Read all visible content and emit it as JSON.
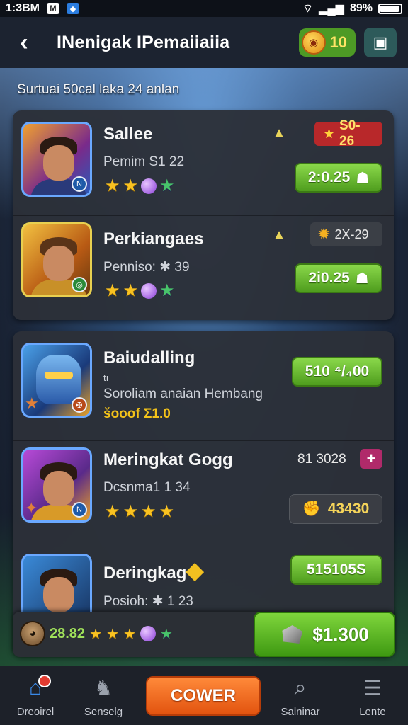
{
  "status_bar": {
    "time": "1:3BM",
    "battery": "89%",
    "battery_level": 0.89
  },
  "header": {
    "title": "INenigak IPemaiiaiia",
    "coins": "10"
  },
  "subtitle": "Surtuai 50cal laka 24 anlan",
  "group1": {
    "items": [
      {
        "name": "Sallee",
        "detail": "Pemim S1 22",
        "price_tag": "S0-26",
        "action": "2:0.25",
        "stars": 2
      },
      {
        "name": "Perkiangaes",
        "detail": "Penniso: ✱ 39",
        "price_tag": "2X-29",
        "action": "2i0.25",
        "stars": 2
      }
    ]
  },
  "group2": {
    "items": [
      {
        "name": "Baiudalling",
        "line1": "tı",
        "detail": "Soroliam anaian Hembang",
        "extra": "šooof Σ1.0",
        "action": "510 ⁴/₄00"
      },
      {
        "name": "Meringkat Gogg",
        "detail": "Dcsnma1 1 34",
        "price_text": "81 3028",
        "action": "43430",
        "stars": 4
      },
      {
        "name": "Deringkag",
        "detail": "Posioh: ✱ 1 23",
        "action": "515105S"
      }
    ]
  },
  "buy_bar": {
    "value": "28.82",
    "price": "$1.300"
  },
  "nav": {
    "items": [
      {
        "label": "Dreoirel"
      },
      {
        "label": "Senselg"
      },
      {
        "label": "Salninar"
      },
      {
        "label": "Lente"
      }
    ],
    "cta_label": "COWER"
  },
  "colors": {
    "accent_green": "#5fb22a",
    "accent_orange": "#f06a1e",
    "badge_red": "#b8282a"
  }
}
